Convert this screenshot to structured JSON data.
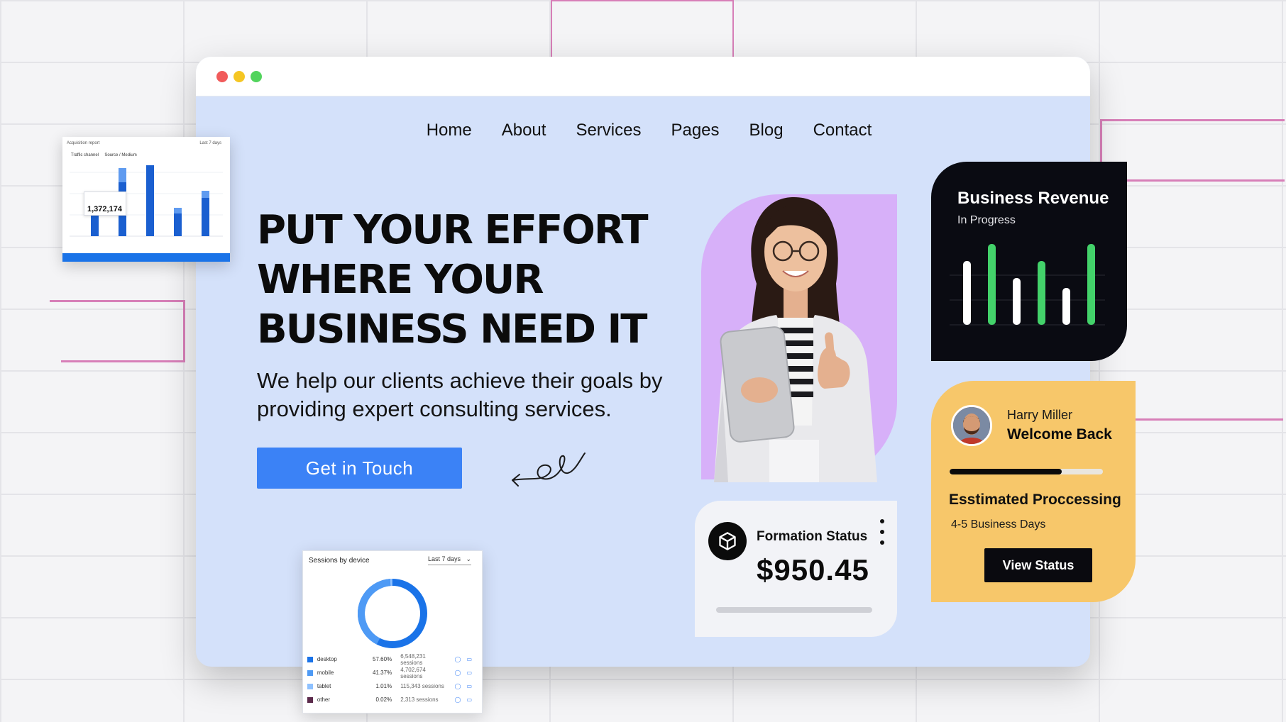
{
  "browser": {
    "window_controls": [
      "close",
      "minimize",
      "maximize"
    ]
  },
  "nav": {
    "items": [
      "Home",
      "About",
      "Services",
      "Pages",
      "Blog",
      "Contact"
    ]
  },
  "hero": {
    "headline": "PUT YOUR EFFORT WHERE YOUR BUSINESS NEED IT",
    "subtext": "We help our clients achieve their goals by providing expert consulting services.",
    "cta_label": "Get in Touch"
  },
  "formation_status": {
    "title": "Formation Status",
    "amount": "$950.45",
    "icon": "box-icon",
    "menu_icon": "more-vertical-icon"
  },
  "business_revenue": {
    "title": "Business Revenue",
    "subtitle": "In Progress",
    "bar_colors": [
      "#ffffff",
      "#43d26a"
    ]
  },
  "welcome_card": {
    "name": "Harry Miller",
    "greeting": "Welcome Back",
    "progress": 0.73,
    "estimate_title": "Esstimated Proccessing",
    "estimate_value": "4-5 Business Days",
    "button_label": "View Status"
  },
  "acquisition_report": {
    "title": "Acquisition report",
    "range": "Last 7 days",
    "tab_channel": "Traffic channel",
    "tab_source": "Source / Medium",
    "tooltip_value": "1,372,174"
  },
  "sessions_by_device": {
    "title": "Sessions by device",
    "range": "Last 7 days",
    "rows": [
      {
        "name": "desktop",
        "pct": "57.60%",
        "sessions": "6,548,231 sessions",
        "color": "#1a73e8"
      },
      {
        "name": "mobile",
        "pct": "41.37%",
        "sessions": "4,702,674 sessions",
        "color": "#4e9af5"
      },
      {
        "name": "tablet",
        "pct": "1.01%",
        "sessions": "115,343 sessions",
        "color": "#8ec1ff"
      },
      {
        "name": "other",
        "pct": "0.02%",
        "sessions": "2,313 sessions",
        "color": "#5b2a4b"
      }
    ]
  },
  "colors": {
    "accent_blue": "#3b82f6",
    "page_bg": "#d4e1fa",
    "purple": "#d7b0f9",
    "dark": "#0a0b12",
    "yellow": "#f7c76a",
    "green": "#43d26a"
  }
}
